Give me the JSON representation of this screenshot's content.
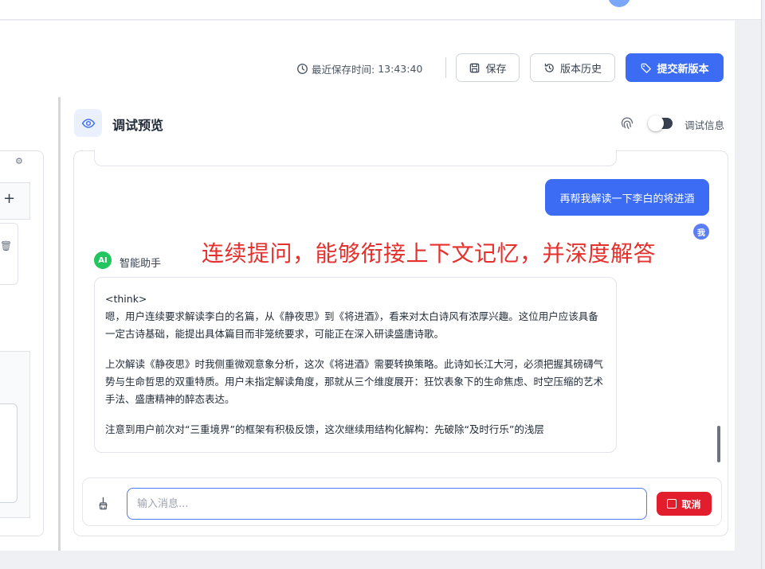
{
  "toolbar": {
    "save_time_label": "最近保存时间:",
    "save_time_value": "13:43:40",
    "save_label": "保存",
    "history_label": "版本历史",
    "submit_label": "提交新版本",
    "accent_color": "#3b6cf3"
  },
  "preview": {
    "title": "调试预览",
    "debug_info_label": "调试信息",
    "debug_toggle_on": false
  },
  "chat": {
    "user_message": "再帮我解读一下李白的将进酒",
    "user_avatar_label": "我",
    "assistant_avatar_label": "AI",
    "assistant_name": "智能助手",
    "assistant_paragraphs": [
      "<think>\n嗯，用户连续要求解读李白的名篇，从《静夜思》到《将进酒》，看来对太白诗风有浓厚兴趣。这位用户应该具备一定古诗基础，能提出具体篇目而非笼统要求，可能正在深入研读盛唐诗歌。",
      "上次解读《静夜思》时我侧重微观意象分析，这次《将进酒》需要转换策略。此诗如长江大河，必须把握其磅礴气势与生命哲思的双重特质。用户未指定解读角度，那就从三个维度展开：狂饮表象下的生命焦虑、时空压缩的艺术手法、盛唐精神的醉态表达。",
      "注意到用户前次对“三重境界”的框架有积极反馈，这次继续用结构化解构：先破除“及时行乐”的浅层"
    ]
  },
  "annotation": "连续提问，能够衔接上下文记忆，并深度解答",
  "input": {
    "placeholder": "输入消息...",
    "value": "",
    "cancel_label": "取消",
    "cancel_color": "#e11d2e"
  },
  "icons": [
    "clock-icon",
    "save-icon",
    "history-icon",
    "tag-icon",
    "eye-icon",
    "fingerprint-icon",
    "broom-icon",
    "stop-icon",
    "gear-icon",
    "plus-icon"
  ]
}
